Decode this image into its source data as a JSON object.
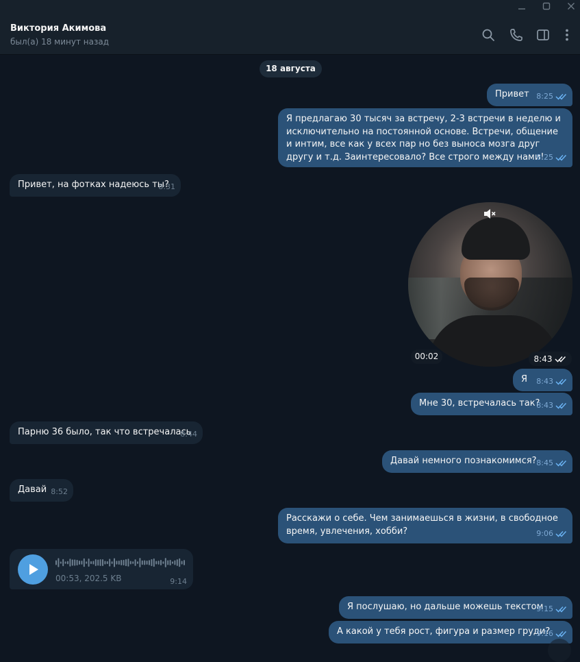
{
  "window": {
    "minimize_icon": "minimize-icon",
    "maximize_icon": "maximize-icon",
    "close_icon": "close-icon"
  },
  "header": {
    "name": "Виктория Акимова",
    "status": "был(а) 18 минут назад",
    "icons": [
      "search-icon",
      "phone-icon",
      "sidebar-icon",
      "more-icon"
    ]
  },
  "chat": {
    "date_separator": "18 августа",
    "messages": [
      {
        "side": "out",
        "text": "Привет",
        "time": "8:25"
      },
      {
        "side": "out",
        "text": "Я предлагаю 30 тысяч за встречу, 2-3 встречи в неделю и исключительно на постоянной основе. Встречи, общение и интим, все как у всех пар но без выноса мозга друг другу и т.д. Заинтересовало? Все строго между нами!",
        "time": "8:25"
      },
      {
        "side": "in",
        "text": "Привет, на фотках надеюсь ты?",
        "time": "8:31"
      },
      {
        "side": "out",
        "type": "video_note",
        "duration": "00:02",
        "time": "8:43"
      },
      {
        "side": "out",
        "text": "Я",
        "time": "8:43"
      },
      {
        "side": "out",
        "text": "Мне 30, встречалась так?",
        "time": "8:43"
      },
      {
        "side": "in",
        "text": "Парню 36 было, так что встречалась",
        "time": "8:44"
      },
      {
        "side": "out",
        "text": "Давай немного познакомимся?",
        "time": "8:45"
      },
      {
        "side": "in",
        "text": "Давай",
        "time": "8:52"
      },
      {
        "side": "out",
        "text": "Расскажи о себе. Чем занимаешься в жизни, в свободное время, увлечения, хобби?",
        "time": "9:06"
      },
      {
        "side": "in",
        "type": "voice",
        "info": "00:53, 202.5 KB",
        "time": "9:14"
      },
      {
        "side": "out",
        "text": "Я послушаю, но дальше можешь текстом",
        "time": "9:15"
      },
      {
        "side": "out",
        "text": "А какой у тебя рост, фигура и размер груди?",
        "time": "9:16"
      }
    ]
  },
  "colors": {
    "background": "#0e1621",
    "header": "#17212b",
    "outgoing_bubble": "#2b5278",
    "incoming_bubble": "#182533",
    "accent": "#4f9fe0",
    "read_checks": "#6ab2f2"
  }
}
